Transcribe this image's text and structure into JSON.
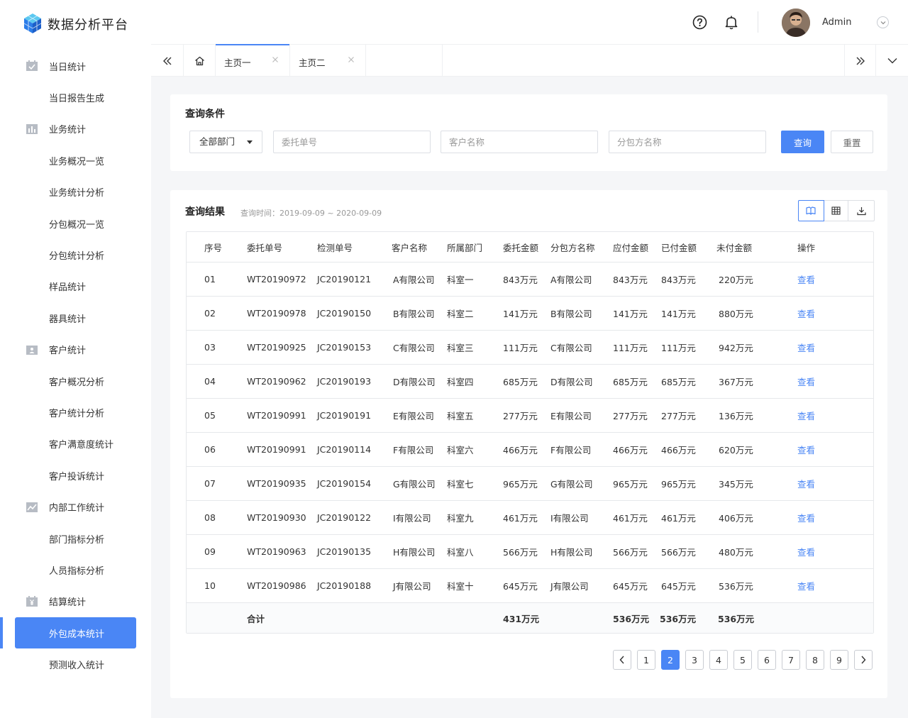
{
  "app": {
    "title": "数据分析平台",
    "user": "Admin"
  },
  "colors": {
    "accent": "#4a86f5",
    "link": "#4a86f5"
  },
  "sidebar": {
    "items": [
      {
        "label": "当日统计",
        "icon": "calendar-check-icon",
        "level": 1
      },
      {
        "label": "当日报告生成",
        "level": 2
      },
      {
        "label": "业务统计",
        "icon": "bar-chart-icon",
        "level": 1
      },
      {
        "label": "业务概况一览",
        "level": 2
      },
      {
        "label": "业务统计分析",
        "level": 2
      },
      {
        "label": "分包概况一览",
        "level": 2
      },
      {
        "label": "分包统计分析",
        "level": 2
      },
      {
        "label": "样品统计",
        "level": 2
      },
      {
        "label": "器具统计",
        "level": 2
      },
      {
        "label": "客户统计",
        "icon": "id-card-icon",
        "level": 1
      },
      {
        "label": "客户概况分析",
        "level": 2
      },
      {
        "label": "客户统计分析",
        "level": 2
      },
      {
        "label": "客户满意度统计",
        "level": 2
      },
      {
        "label": "客户投诉统计",
        "level": 2
      },
      {
        "label": "内部工作统计",
        "icon": "line-chart-icon",
        "level": 1
      },
      {
        "label": "部门指标分析",
        "level": 2
      },
      {
        "label": "人员指标分析",
        "level": 2
      },
      {
        "label": "结算统计",
        "icon": "yen-icon",
        "level": 1
      },
      {
        "label": "外包成本统计",
        "level": 2,
        "active": true
      },
      {
        "label": "预测收入统计",
        "level": 2
      }
    ]
  },
  "tabs": [
    {
      "label": "主页一",
      "active": true
    },
    {
      "label": "主页二",
      "active": false
    }
  ],
  "query": {
    "title": "查询条件",
    "department": "全部部门",
    "order_placeholder": "委托单号",
    "customer_placeholder": "客户名称",
    "subcontractor_placeholder": "分包方名称",
    "search_label": "查询",
    "reset_label": "重置"
  },
  "results": {
    "title": "查询结果",
    "time_range": "查询时间：2019-09-09 ~ 2020-09-09",
    "columns": [
      "序号",
      "委托单号",
      "检测单号",
      "客户名称",
      "所属部门",
      "委托金额",
      "分包方名称",
      "应付金额",
      "已付金额",
      "未付金额",
      "操作"
    ],
    "rows": [
      [
        "01",
        "WT20190972",
        "JC20190121",
        "A有限公司",
        "科室一",
        "843万元",
        "A有限公司",
        "843万元",
        "843万元",
        "220万元",
        "查看"
      ],
      [
        "02",
        "WT20190978",
        "JC20190150",
        "B有限公司",
        "科室二",
        "141万元",
        "B有限公司",
        "141万元",
        "141万元",
        "880万元",
        "查看"
      ],
      [
        "03",
        "WT20190925",
        "JC20190153",
        "C有限公司",
        "科室三",
        "111万元",
        "C有限公司",
        "111万元",
        "111万元",
        "942万元",
        "查看"
      ],
      [
        "04",
        "WT20190962",
        "JC20190193",
        "D有限公司",
        "科室四",
        "685万元",
        "D有限公司",
        "685万元",
        "685万元",
        "367万元",
        "查看"
      ],
      [
        "05",
        "WT20190991",
        "JC20190191",
        "E有限公司",
        "科室五",
        "277万元",
        "E有限公司",
        "277万元",
        "277万元",
        "136万元",
        "查看"
      ],
      [
        "06",
        "WT20190991",
        "JC20190114",
        "F有限公司",
        "科室六",
        "466万元",
        "F有限公司",
        "466万元",
        "466万元",
        "620万元",
        "查看"
      ],
      [
        "07",
        "WT20190935",
        "JC20190154",
        "G有限公司",
        "科室七",
        "965万元",
        "G有限公司",
        "965万元",
        "965万元",
        "345万元",
        "查看"
      ],
      [
        "08",
        "WT20190930",
        "JC20190122",
        "I有限公司",
        "科室九",
        "461万元",
        "I有限公司",
        "461万元",
        "461万元",
        "406万元",
        "查看"
      ],
      [
        "09",
        "WT20190963",
        "JC20190135",
        "H有限公司",
        "科室八",
        "566万元",
        "H有限公司",
        "566万元",
        "566万元",
        "480万元",
        "查看"
      ],
      [
        "10",
        "WT20190986",
        "JC20190188",
        "J有限公司",
        "科室十",
        "645万元",
        "J有限公司",
        "645万元",
        "645万元",
        "536万元",
        "查看"
      ]
    ],
    "total": {
      "label": "合计",
      "order_amount": "431万元",
      "payable": "536万元",
      "paid": "536万元",
      "unpaid": "536万元"
    }
  },
  "pagination": {
    "pages": [
      "1",
      "2",
      "3",
      "4",
      "5",
      "6",
      "7",
      "8",
      "9"
    ],
    "current": "2"
  }
}
